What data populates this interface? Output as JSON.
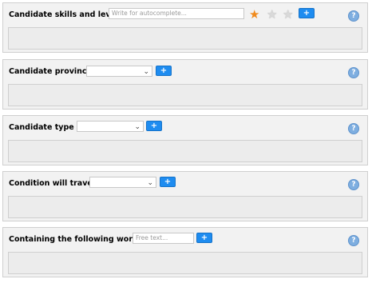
{
  "colors": {
    "accent": "#1e8cf0",
    "star_active": "#f08a1c",
    "star_inactive": "#d9d9d9",
    "help": "#7eaee0"
  },
  "rating": {
    "value": 1,
    "max": 3
  },
  "panels": [
    {
      "title": "Candidate skills and level",
      "input_placeholder": "Write for autocomplete...",
      "add_label": "+",
      "help_label": "?"
    },
    {
      "title": "Candidate province",
      "select_value": "",
      "add_label": "+",
      "help_label": "?"
    },
    {
      "title": "Candidate type",
      "select_value": "",
      "add_label": "+",
      "help_label": "?"
    },
    {
      "title": "Condition will travel",
      "select_value": "",
      "add_label": "+",
      "help_label": "?"
    },
    {
      "title": "Containing the following words",
      "input_placeholder": "Free text...",
      "add_label": "+",
      "help_label": "?"
    }
  ]
}
